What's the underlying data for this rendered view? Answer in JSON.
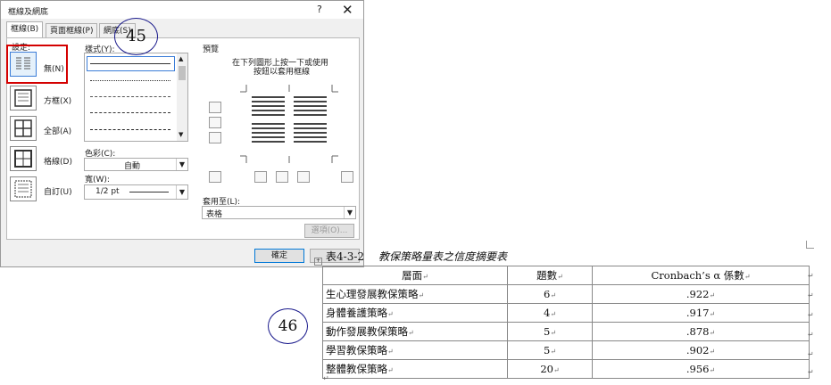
{
  "dialog": {
    "title": "框線及網底",
    "help": "?",
    "close": "✕",
    "tabs": [
      {
        "label": "框線(B)"
      },
      {
        "label": "頁面框線(P)"
      },
      {
        "label": "網底(S)"
      }
    ],
    "setting_label": "設定:",
    "settings": [
      {
        "label": "無(N)",
        "icon": "no-border-icon",
        "selected": true
      },
      {
        "label": "方框(X)",
        "icon": "box-border-icon"
      },
      {
        "label": "全部(A)",
        "icon": "all-borders-icon"
      },
      {
        "label": "格線(D)",
        "icon": "grid-borders-icon"
      },
      {
        "label": "自訂(U)",
        "icon": "custom-border-icon"
      }
    ],
    "style_label": "樣式(Y):",
    "color_label": "色彩(C):",
    "color_value": "自動",
    "width_label": "寬(W):",
    "width_value": "1/2 pt",
    "preview_label": "預覽",
    "preview_hint_line1": "在下列圖形上按一下或使用",
    "preview_hint_line2": "按鈕以套用框線",
    "apply_to_label": "套用至(L):",
    "apply_to_value": "表格",
    "options_button": "選項(O)...",
    "ok_button": "確定"
  },
  "annotations": {
    "first": "45",
    "second": "46"
  },
  "table": {
    "caption_number": "表4-3-2",
    "caption_title": "教保策略量表之信度摘要表",
    "cell_mark": "↵",
    "headers": [
      "層面",
      "題數",
      "Cronbach’s α 係數"
    ],
    "rows": [
      [
        "生心理發展教保策略",
        "6",
        ".922"
      ],
      [
        "身體養護策略",
        "4",
        ".917"
      ],
      [
        "動作發展教保策略",
        "5",
        ".878"
      ],
      [
        "學習教保策略",
        "5",
        ".902"
      ],
      [
        "整體教保策略",
        "20",
        ".956"
      ]
    ]
  }
}
